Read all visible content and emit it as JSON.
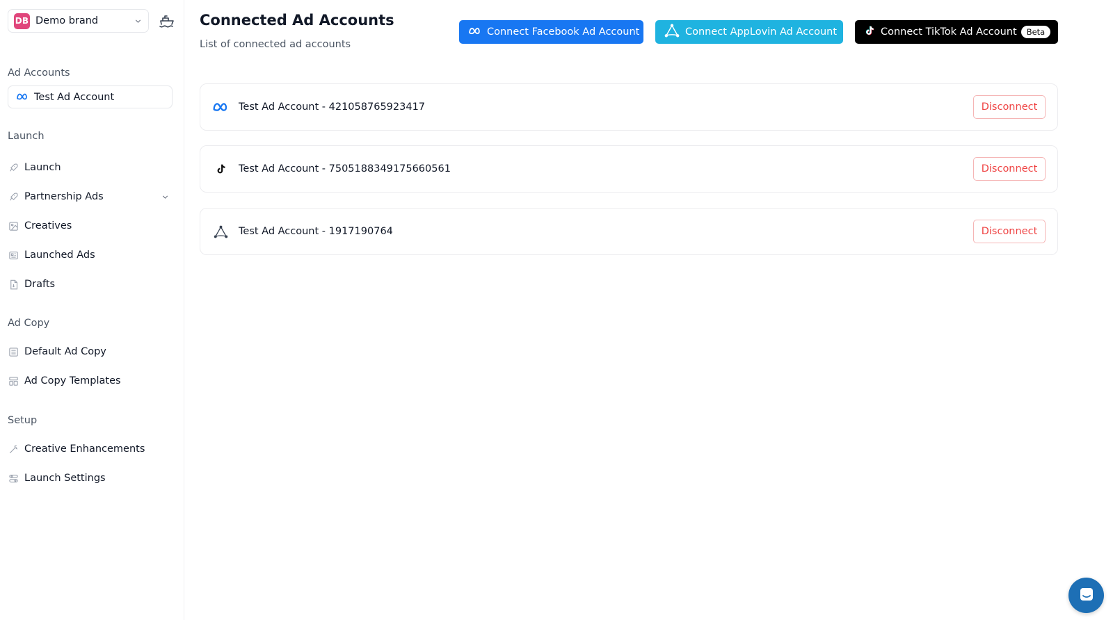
{
  "brand": {
    "initials": "DB",
    "name": "Demo brand",
    "avatar_color": "#e0457b"
  },
  "sidebar": {
    "ad_accounts_label": "Ad Accounts",
    "active_account": "Test Ad Account",
    "launch_label": "Launch",
    "launch_items": [
      {
        "label": "Launch",
        "icon": "rocket-icon"
      },
      {
        "label": "Partnership Ads",
        "icon": "rocket-icon"
      },
      {
        "label": "Creatives",
        "icon": "image-icon"
      },
      {
        "label": "Launched Ads",
        "icon": "newspaper-icon"
      },
      {
        "label": "Drafts",
        "icon": "file-icon"
      }
    ],
    "ad_copy_label": "Ad Copy",
    "ad_copy_items": [
      {
        "label": "Default Ad Copy",
        "icon": "list-icon"
      },
      {
        "label": "Ad Copy Templates",
        "icon": "layout-icon"
      }
    ],
    "setup_label": "Setup",
    "setup_items": [
      {
        "label": "Creative Enhancements",
        "icon": "wand-icon"
      },
      {
        "label": "Launch Settings",
        "icon": "settings-toggle-icon"
      }
    ]
  },
  "main": {
    "title": "Connected Ad Accounts",
    "subtitle": "List of connected ad accounts",
    "buttons": {
      "facebook": "Connect Facebook Ad Account",
      "applovin": "Connect AppLovin Ad Account",
      "tiktok": "Connect TikTok Ad Account",
      "beta": "Beta"
    },
    "accounts": [
      {
        "name": "Test Ad Account - 421058765923417",
        "platform": "meta-icon",
        "action": "Disconnect"
      },
      {
        "name": "Test Ad Account - 7505188349175660561",
        "platform": "tiktok-icon",
        "action": "Disconnect"
      },
      {
        "name": "Test Ad Account - 1917190764",
        "platform": "applovin-icon",
        "action": "Disconnect"
      }
    ]
  },
  "colors": {
    "facebook": "#1877f2",
    "applovin": "#1fb3e0",
    "tiktok": "#000000",
    "danger": "#ef4444",
    "chat": "#1d6fb5"
  }
}
